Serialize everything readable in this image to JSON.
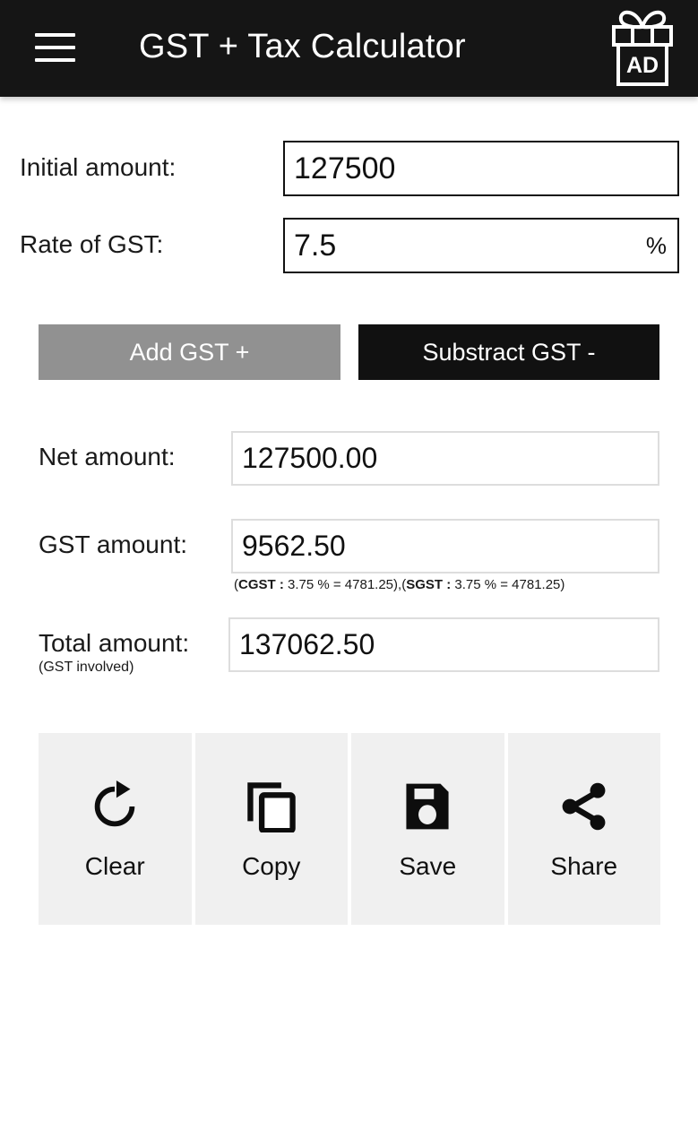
{
  "appbar": {
    "menu_icon": "hamburger-menu-icon",
    "title": "GST + Tax Calculator",
    "ad_icon": "gift-ad-icon",
    "ad_label": "AD",
    "background": "#151515",
    "text_color": "#ffffff"
  },
  "inputs": [
    {
      "label": "Initial amount:",
      "value": "127500",
      "placeholder": "",
      "suffix": ""
    },
    {
      "label": "Rate of GST:",
      "value": "7.5",
      "placeholder": "",
      "suffix": "%"
    }
  ],
  "mode_buttons": {
    "add": {
      "label": "Add GST +",
      "color": "#919191",
      "selected": "false"
    },
    "subtract": {
      "label": "Substract GST -",
      "color": "#111111",
      "selected": "true"
    }
  },
  "results": {
    "net": {
      "label": "Net amount:",
      "value": "127500.00"
    },
    "gst": {
      "label": "GST amount:",
      "value": "9562.50",
      "split_open": "(",
      "cgst_name": "CGST :",
      "cgst_detail": " 3.75 % = 4781.25),(",
      "sgst_name": "SGST :",
      "sgst_detail": " 3.75 % = 4781.25)"
    },
    "total": {
      "label": "Total amount:",
      "sublabel": "(GST involved)",
      "value": "137062.50"
    }
  },
  "actions": [
    {
      "label": "Clear",
      "icon": "refresh-icon"
    },
    {
      "label": "Copy",
      "icon": "copy-icon"
    },
    {
      "label": "Save",
      "icon": "floppy-disk-icon"
    },
    {
      "label": "Share",
      "icon": "share-nodes-icon"
    }
  ]
}
